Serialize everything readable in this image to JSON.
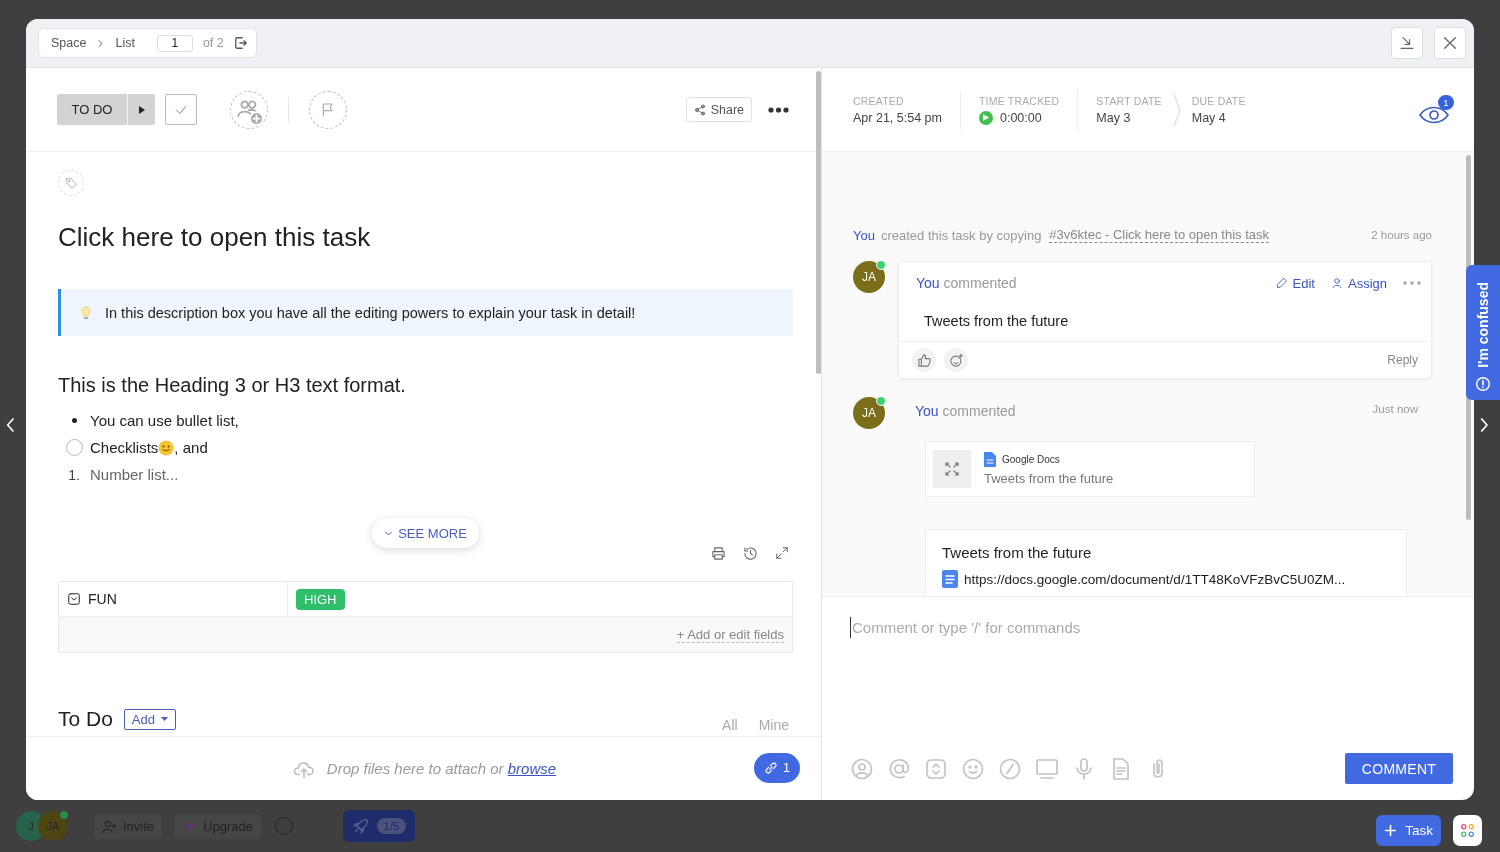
{
  "breadcrumb": {
    "items": [
      "Space",
      "List"
    ],
    "page": "1",
    "of": "of 2"
  },
  "toolbar": {
    "status": "TO DO",
    "share": "Share"
  },
  "meta": [
    {
      "kind": "plain",
      "label": "CREATED",
      "value": "Apr 21, 5:54 pm"
    },
    {
      "kind": "timer",
      "label": "TIME TRACKED",
      "value": "0:00:00"
    },
    {
      "kind": "plain",
      "label": "START DATE",
      "value": "May 3"
    },
    {
      "kind": "due",
      "label": "DUE DATE",
      "value": "May 4"
    }
  ],
  "watchers": "1",
  "task": {
    "title": "Click here to open this task",
    "callout": "In this description box you have all the editing powers to explain your task in detail!",
    "heading": "This is the Heading 3 or H3 text format.",
    "list": [
      {
        "kind": "bullet",
        "text": "You can use bullet list,"
      },
      {
        "kind": "check",
        "checked": false,
        "text": "Checklists",
        "after_emoji": ", and"
      },
      {
        "kind": "number",
        "marker": "1.",
        "text": "Number list..."
      }
    ],
    "see_more": "SEE MORE"
  },
  "fields": [
    {
      "name": "FUN",
      "value": "HIGH"
    }
  ],
  "add_fields": "+ Add or edit fields",
  "todo": {
    "title": "To Do",
    "add": "Add",
    "filters": [
      "All",
      "Mine"
    ]
  },
  "attach": {
    "text": "Drop files here to attach or",
    "link": "browse",
    "count": "1"
  },
  "activity": {
    "created": {
      "actor": "You",
      "text": "created this task by copying",
      "link": "#3v6ktec - Click here to open this task",
      "time": "2 hours ago"
    },
    "comments": [
      {
        "kind": "text",
        "initials": "JA",
        "online": true,
        "actor": "You",
        "verb": "commented",
        "actions": [
          "Edit",
          "Assign"
        ],
        "body": "Tweets from the future",
        "reply": "Reply"
      },
      {
        "kind": "attachment",
        "initials": "JA",
        "online": true,
        "actor": "You",
        "verb": "commented",
        "time": "Just now",
        "file": {
          "source": "Google Docs",
          "title": "Tweets from the future"
        },
        "embed": {
          "title": "Tweets from the future",
          "url": "https://docs.google.com/document/d/1TT48KoVFzBvC5U0ZM..."
        }
      }
    ]
  },
  "composer": {
    "placeholder": "Comment or type '/' for commands",
    "button": "COMMENT"
  },
  "help_tab": "I'm confused",
  "footer": {
    "avatars": [
      {
        "initials": "J",
        "online": false
      },
      {
        "initials": "JA",
        "online": true
      }
    ],
    "invite": "Invite",
    "upgrade": "Upgrade",
    "progress": "1/5",
    "new_task": "Task"
  }
}
